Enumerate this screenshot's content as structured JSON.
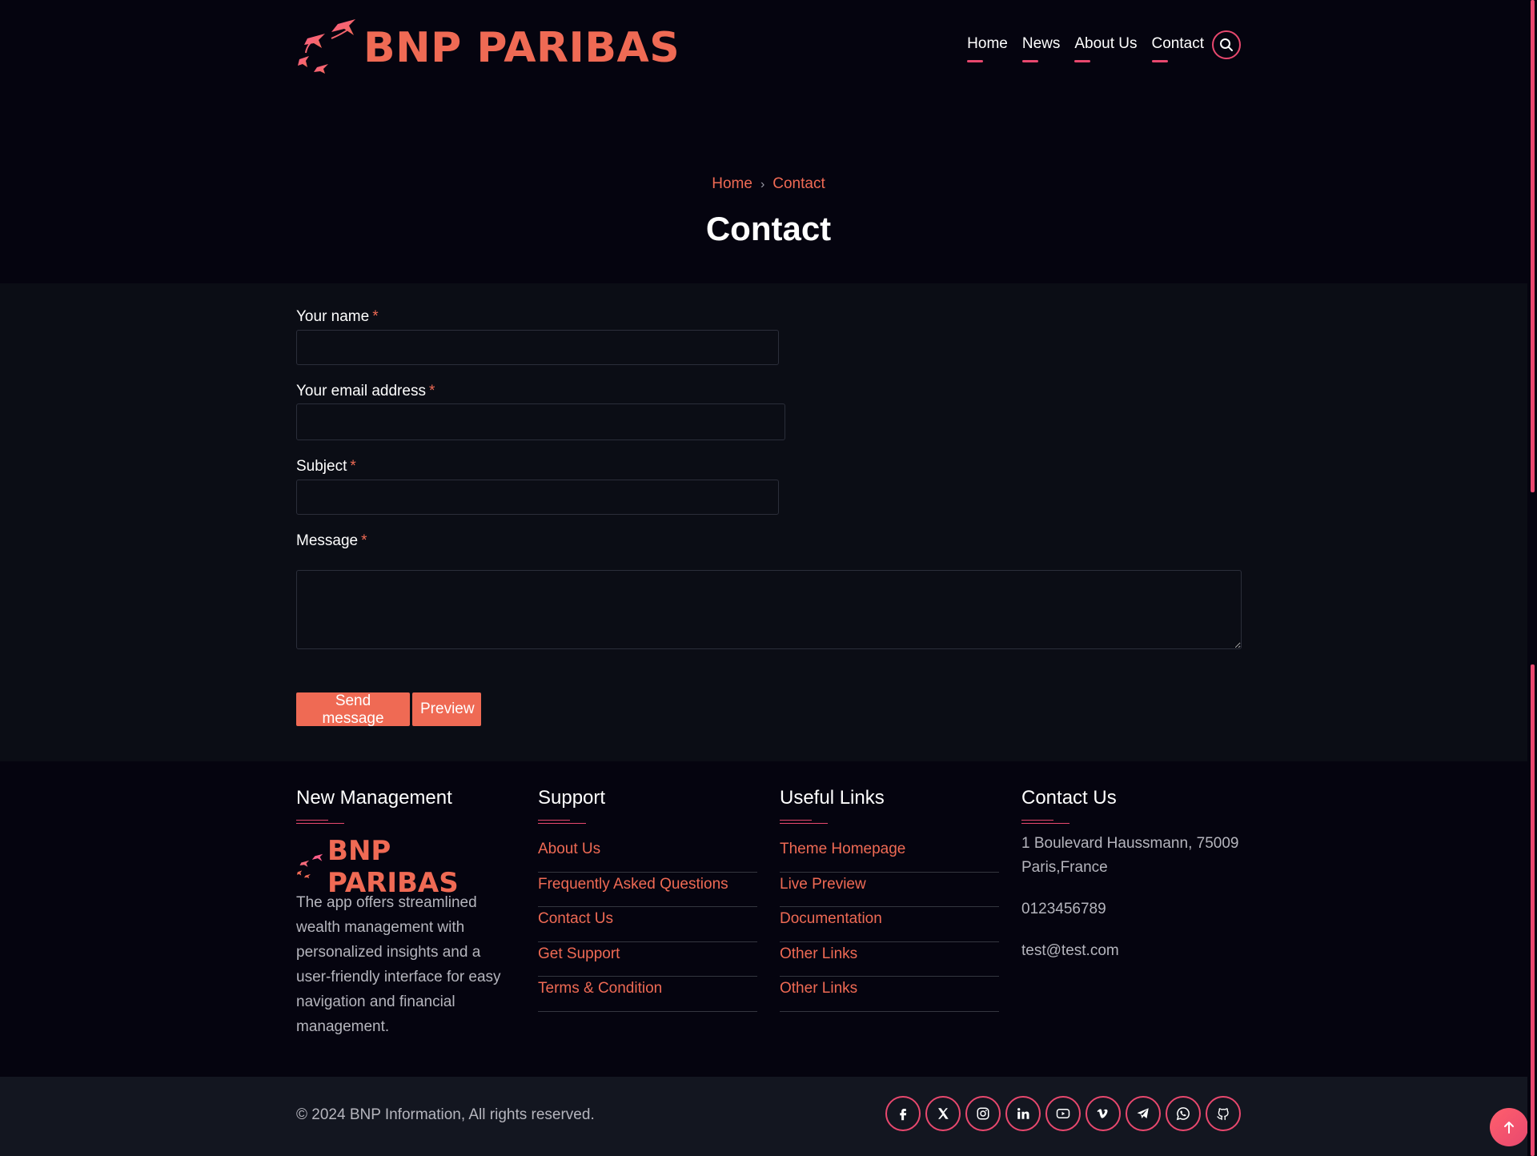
{
  "brand": {
    "name": "BNP PARIBAS",
    "accent": "#ef6a54",
    "pink": "#e8486e"
  },
  "nav": {
    "items": [
      {
        "label": "Home"
      },
      {
        "label": "News"
      },
      {
        "label": "About Us"
      },
      {
        "label": "Contact"
      }
    ],
    "search_icon": "search-icon"
  },
  "breadcrumb": {
    "home": "Home",
    "current": "Contact"
  },
  "page": {
    "title": "Contact"
  },
  "form": {
    "name_label": "Your name",
    "email_label": "Your email address",
    "subject_label": "Subject",
    "message_label": "Message",
    "required_mark": "*",
    "name_value": "",
    "email_value": "",
    "subject_value": "",
    "message_value": "",
    "send_label": "Send message",
    "preview_label": "Preview"
  },
  "footer": {
    "col1": {
      "title": "New Management",
      "brand": "BNP PARIBAS",
      "description": "The app offers streamlined wealth management with personalized insights and a user-friendly interface for easy navigation and financial management."
    },
    "col2": {
      "title": "Support",
      "links": [
        "About Us",
        "Frequently Asked Questions",
        "Contact Us",
        "Get Support",
        "Terms & Condition"
      ]
    },
    "col3": {
      "title": "Useful Links",
      "links": [
        "Theme Homepage",
        "Live Preview",
        "Documentation",
        "Other Links",
        "Other Links"
      ]
    },
    "col4": {
      "title": "Contact Us",
      "address": "1 Boulevard Haussmann, 75009 Paris,France",
      "phone": "0123456789",
      "email": "test@test.com"
    }
  },
  "bottombar": {
    "copyright": "© 2024 BNP Information, All rights reserved.",
    "social": [
      "facebook-icon",
      "x-icon",
      "instagram-icon",
      "linkedin-icon",
      "youtube-icon",
      "vimeo-icon",
      "telegram-icon",
      "whatsapp-icon",
      "github-icon"
    ]
  }
}
